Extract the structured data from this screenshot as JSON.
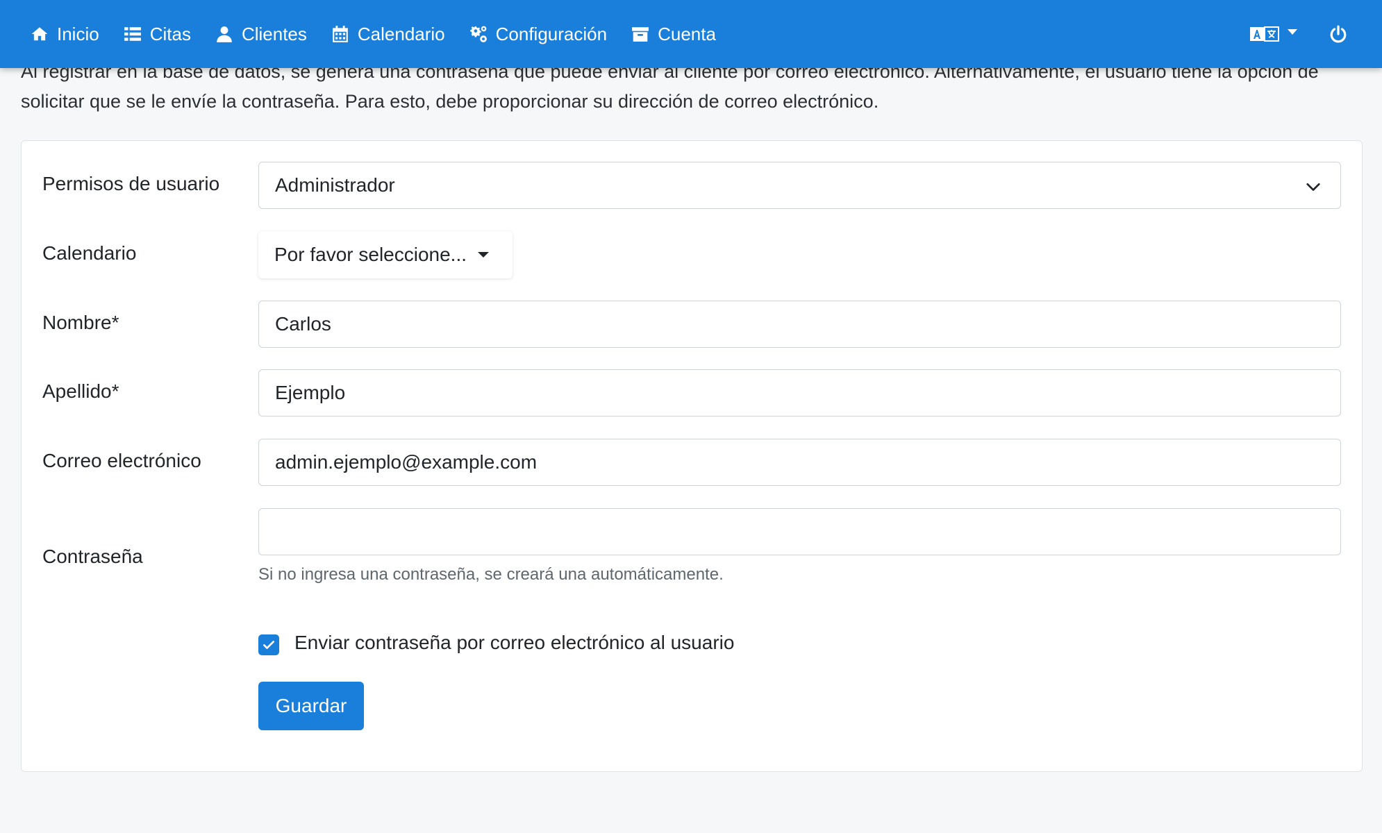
{
  "nav": {
    "items": [
      {
        "label": "Inicio",
        "icon": "home-icon"
      },
      {
        "label": "Citas",
        "icon": "list-icon"
      },
      {
        "label": "Clientes",
        "icon": "user-icon"
      },
      {
        "label": "Calendario",
        "icon": "calendar-icon"
      },
      {
        "label": "Configuración",
        "icon": "cogs-icon"
      },
      {
        "label": "Cuenta",
        "icon": "archive-icon"
      }
    ],
    "language_icon": "language-icon",
    "logout_icon": "power-icon"
  },
  "intro": {
    "text": "Al registrar en la base de datos, se genera una contraseña que puede enviar al cliente por correo electrónico. Alternativamente, el usuario tiene la opción de solicitar que se le envíe la contraseña. Para esto, debe proporcionar su dirección de correo electrónico."
  },
  "form": {
    "permissions": {
      "label": "Permisos de usuario",
      "value": "Administrador"
    },
    "calendar": {
      "label": "Calendario",
      "value": "Por favor seleccione..."
    },
    "first_name": {
      "label": "Nombre*",
      "value": "Carlos"
    },
    "last_name": {
      "label": "Apellido*",
      "value": "Ejemplo"
    },
    "email": {
      "label": "Correo electrónico",
      "value": "admin.ejemplo@example.com"
    },
    "password": {
      "label": "Contraseña",
      "value": "",
      "help": "Si no ingresa una contraseña, se creará una automáticamente."
    },
    "send_password": {
      "label": "Enviar contraseña por correo electrónico al usuario",
      "checked": true
    },
    "save_label": "Guardar"
  },
  "colors": {
    "primary": "#1a7fdb",
    "background": "#f6f7f9"
  }
}
